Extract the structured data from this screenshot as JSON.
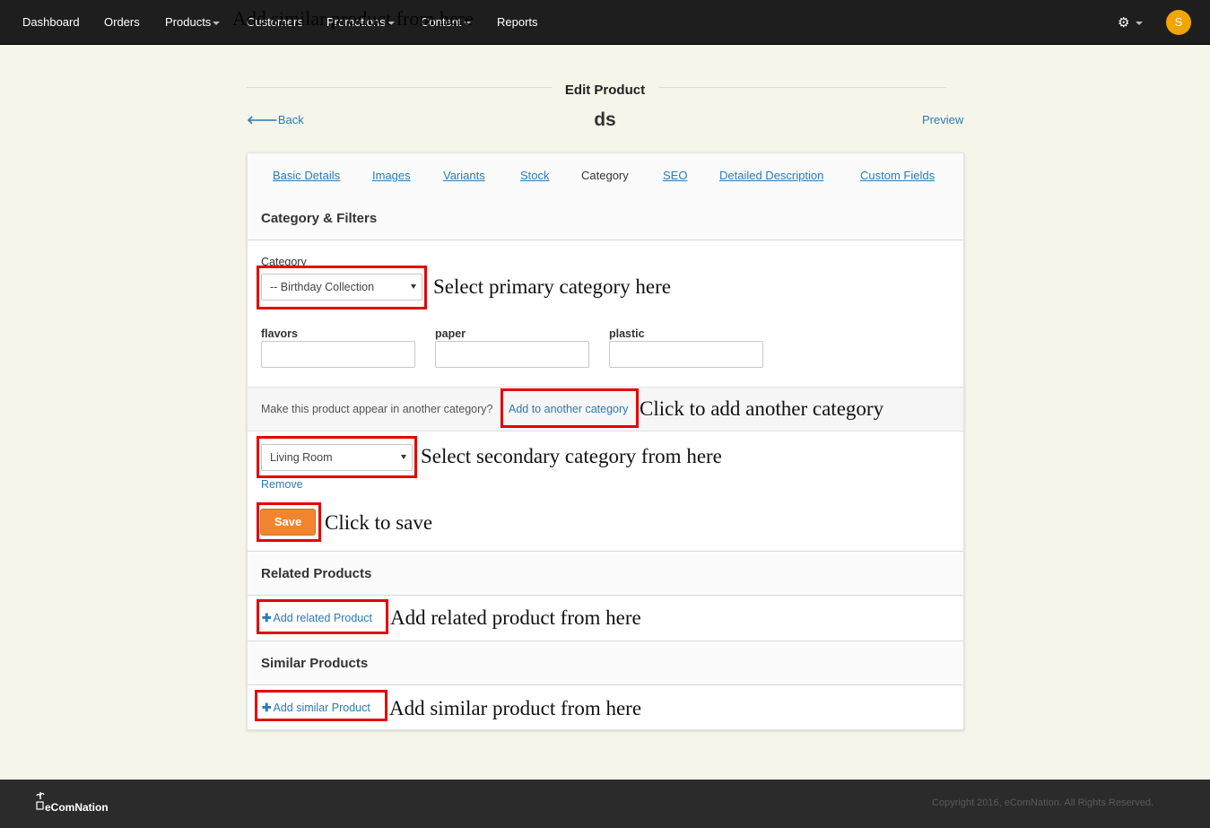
{
  "nav": {
    "items": [
      "Dashboard",
      "Orders",
      "Products",
      "Customers",
      "Promotions",
      "Content",
      "Reports"
    ],
    "overlay_text": "Add similar product from here",
    "avatar_letter": "S"
  },
  "header": {
    "page_heading": "Edit Product",
    "product_name": "ds",
    "back_label": "Back",
    "preview_label": "Preview"
  },
  "tabs": [
    "Basic Details",
    "Images",
    "Variants",
    "Stock",
    "Category",
    "SEO",
    "Detailed Description",
    "Custom Fields"
  ],
  "category_section": {
    "title": "Category & Filters",
    "category_label": "Category",
    "category_value": "-- Birthday Collection",
    "filters": [
      "flavors",
      "paper",
      "plastic"
    ],
    "another_prompt": "Make this product appear in another category?",
    "add_another_label": "Add to another category",
    "secondary_value": "Living Room",
    "remove_label": "Remove",
    "save_label": "Save"
  },
  "related": {
    "title": "Related Products",
    "add_label": "Add related Product"
  },
  "similar": {
    "title": "Similar Products",
    "add_label": "Add similar Product"
  },
  "callouts": {
    "primary": "Select primary category here",
    "another": "Click to add another category",
    "secondary": "Select secondary category from here",
    "save": "Click to save",
    "related": "Add related product from here",
    "similar": "Add similar product from here"
  },
  "footer": {
    "logo_text": "eComNation",
    "copyright": "Copyright 2016, eComNation. All Rights Reserved."
  },
  "colors": {
    "accent_orange": "#f0852d",
    "link_blue": "#2a7ab8",
    "annotation_red": "#e60000",
    "navbar_bg": "#1e1e1e"
  }
}
